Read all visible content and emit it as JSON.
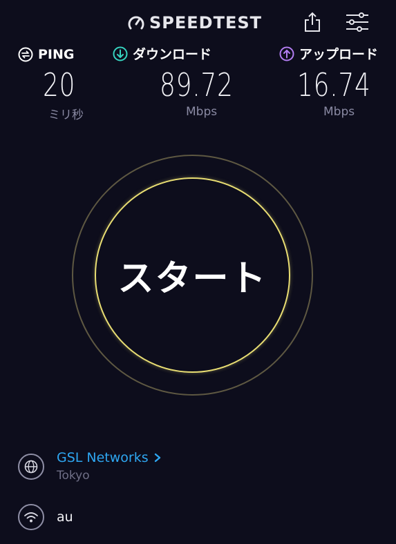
{
  "header": {
    "brand": "SPEEDTEST",
    "brand_icon": "speedometer-icon",
    "share_icon": "share-icon",
    "settings_icon": "sliders-icon"
  },
  "metrics": {
    "ping": {
      "label": "PING",
      "value": "20",
      "unit": "ミリ秒",
      "icon": "ping-icon",
      "icon_color": "#ffffff"
    },
    "download": {
      "label": "ダウンロード",
      "value": "89.72",
      "unit": "Mbps",
      "icon": "download-arrow-icon",
      "icon_color": "#36d4c0"
    },
    "upload": {
      "label": "アップロード",
      "value": "16.74",
      "unit": "Mbps",
      "icon": "upload-arrow-icon",
      "icon_color": "#b27df2"
    }
  },
  "start": {
    "label": "スタート",
    "ring_color": "#e9de73",
    "outer_ring_color": "#5e5842"
  },
  "server": {
    "name": "GSL Networks",
    "location": "Tokyo",
    "icon": "globe-icon",
    "name_color": "#2ea7f2"
  },
  "connection": {
    "carrier": "au",
    "icon": "wifi-icon"
  },
  "colors": {
    "background": "#0d0d1c"
  }
}
